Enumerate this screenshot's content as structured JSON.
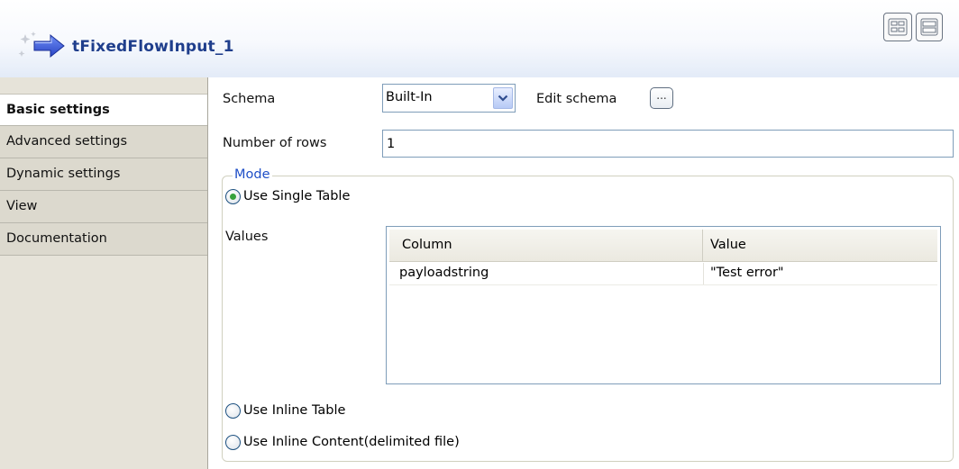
{
  "header": {
    "component_title": "tFixedFlowInput_1",
    "icon": "arrow-flow-icon",
    "layout_buttons": [
      "grid-layout-icon",
      "stacked-layout-icon"
    ]
  },
  "tabs": [
    {
      "label": "Basic settings",
      "active": true
    },
    {
      "label": "Advanced settings",
      "active": false
    },
    {
      "label": "Dynamic settings",
      "active": false
    },
    {
      "label": "View",
      "active": false
    },
    {
      "label": "Documentation",
      "active": false
    }
  ],
  "form": {
    "schema_label": "Schema",
    "schema_value": "Built-In",
    "edit_schema_label": "Edit schema",
    "edit_schema_button": "...",
    "rows_label": "Number of rows",
    "rows_value": "1",
    "mode_title": "Mode",
    "mode_options": [
      {
        "label": "Use Single Table",
        "selected": true
      },
      {
        "label": "Use Inline Table",
        "selected": false
      },
      {
        "label": "Use Inline Content(delimited file)",
        "selected": false
      }
    ],
    "values_label": "Values"
  },
  "values_table": {
    "columns": [
      "Column",
      "Value"
    ],
    "rows": [
      {
        "column": "payloadstring",
        "value": "\"Test error\""
      }
    ]
  },
  "colors": {
    "title_blue": "#1f3e8c",
    "mode_blue": "#1f4fc7",
    "radio_green": "#36a13b",
    "tab_panel": "#e6e3d9"
  }
}
